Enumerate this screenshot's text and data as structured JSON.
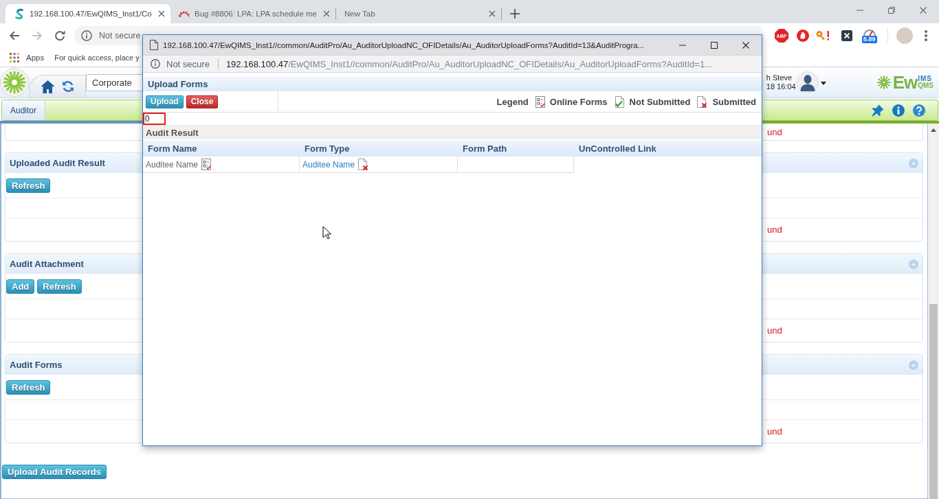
{
  "browser": {
    "tabs": [
      {
        "title": "192.168.100.47/EwQIMS_Inst1/Co",
        "kind": "app",
        "selected": true
      },
      {
        "title": "Bug #8806: LPA: LPA schedule me",
        "kind": "tracker",
        "selected": false
      },
      {
        "title": "New Tab",
        "kind": "blank",
        "selected": false
      }
    ],
    "address_bar": {
      "security": "Not secure"
    },
    "extensions": [
      {
        "kind": "octagon",
        "label": "ABP"
      },
      {
        "kind": "hand"
      },
      {
        "kind": "key"
      },
      {
        "kind": "x_square"
      },
      {
        "kind": "gauge",
        "badge": "5.89"
      }
    ],
    "bookmarks": {
      "apps": "Apps",
      "hint": "For quick access, place y"
    }
  },
  "app_header": {
    "org_select": "Corporate",
    "user_name": "h Steve",
    "login_time": "18 16:04",
    "logo": {
      "main": "Ew",
      "top": "IMS",
      "bottom": "QMS"
    }
  },
  "nav": {
    "tabs": [
      {
        "label": "Auditor",
        "selected": true
      }
    ]
  },
  "panels": [
    {
      "rows": [
        {
          "kind": "message",
          "text": "und"
        }
      ]
    },
    {
      "title": "Uploaded Audit Result",
      "expanded": true,
      "buttons": [
        "Refresh"
      ],
      "rows": [
        {
          "kind": "blank"
        },
        {
          "kind": "message",
          "text": "und"
        }
      ]
    },
    {
      "title": "Audit Attachment",
      "expanded": true,
      "buttons": [
        "Add",
        "Refresh"
      ],
      "rows": [
        {
          "kind": "blank"
        },
        {
          "kind": "message",
          "text": "und"
        }
      ]
    },
    {
      "title": "Audit Forms",
      "expanded": true,
      "buttons": [
        "Refresh"
      ],
      "rows": [
        {
          "kind": "blank"
        },
        {
          "kind": "message",
          "text": "und"
        }
      ]
    }
  ],
  "footer_button": "Upload Audit Records",
  "popup": {
    "title": "192.168.100.47/EwQIMS_Inst1//common/AuditPro/Au_AuditorUploadNC_OFIDetails/Au_AuditorUploadForms?AuditId=13&AuditProgra...",
    "address_bar": {
      "security": "Not secure",
      "host": "192.168.100.47",
      "path": "/EwQIMS_Inst1//common/AuditPro/Au_AuditorUploadNC_OFIDetails/Au_AuditorUploadForms?AuditId=1..."
    },
    "section_title": "Upload Forms",
    "buttons": [
      {
        "label": "Upload",
        "kind": "upload"
      },
      {
        "label": "Close",
        "kind": "close"
      }
    ],
    "legend": {
      "label": "Legend",
      "items": [
        {
          "kind": "online",
          "label": "Online Forms"
        },
        {
          "kind": "not_submitted",
          "label": "Not Submitted"
        },
        {
          "kind": "submitted",
          "label": "Submitted"
        }
      ]
    },
    "count_field": {
      "value": "0",
      "error": true
    },
    "result_title": "Audit Result",
    "table": {
      "columns": [
        "Form Name",
        "Form Type",
        "Form Path",
        "UnControlled Link"
      ],
      "rows": [
        [
          {
            "text": "Auditee Name",
            "kind": "online"
          },
          {
            "text": "Auditee Name",
            "kind": "submitted"
          }
        ]
      ]
    }
  }
}
